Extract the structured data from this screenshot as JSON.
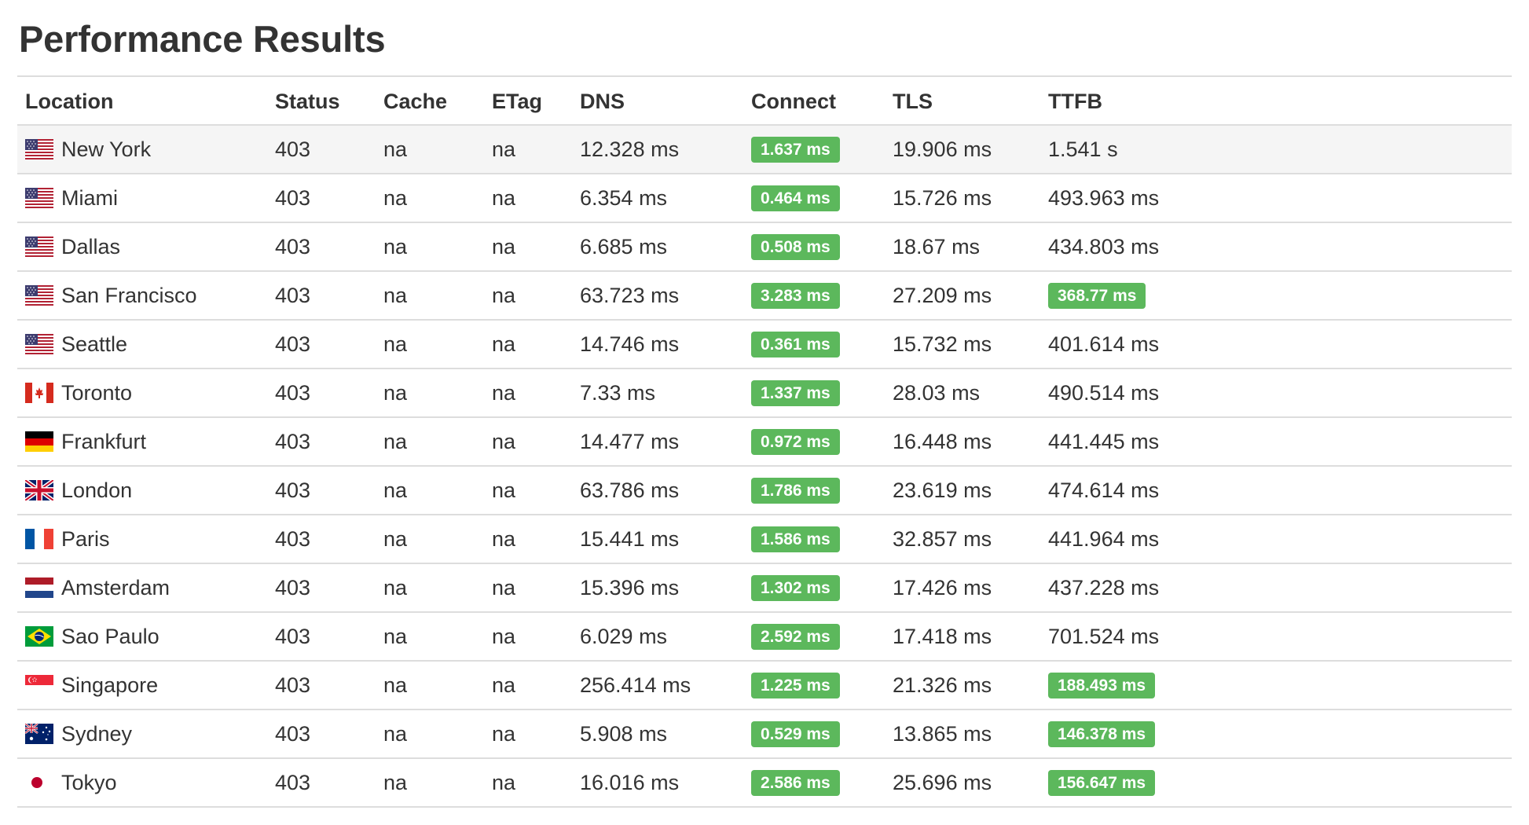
{
  "title": "Performance Results",
  "columns": [
    "Location",
    "Status",
    "Cache",
    "ETag",
    "DNS",
    "Connect",
    "TLS",
    "TTFB"
  ],
  "colors": {
    "badge_green": "#5cb85c",
    "row_highlight": "#f5f5f5",
    "border": "#dddddd"
  },
  "rows": [
    {
      "flag": "us-flag-icon",
      "location": "New York",
      "status": "403",
      "cache": "na",
      "etag": "na",
      "dns": "12.328 ms",
      "connect": "1.637 ms",
      "connect_highlight": true,
      "tls": "19.906 ms",
      "ttfb": "1.541 s",
      "ttfb_highlight": false
    },
    {
      "flag": "us-flag-icon",
      "location": "Miami",
      "status": "403",
      "cache": "na",
      "etag": "na",
      "dns": "6.354 ms",
      "connect": "0.464 ms",
      "connect_highlight": true,
      "tls": "15.726 ms",
      "ttfb": "493.963 ms",
      "ttfb_highlight": false
    },
    {
      "flag": "us-flag-icon",
      "location": "Dallas",
      "status": "403",
      "cache": "na",
      "etag": "na",
      "dns": "6.685 ms",
      "connect": "0.508 ms",
      "connect_highlight": true,
      "tls": "18.67 ms",
      "ttfb": "434.803 ms",
      "ttfb_highlight": false
    },
    {
      "flag": "us-flag-icon",
      "location": "San Francisco",
      "status": "403",
      "cache": "na",
      "etag": "na",
      "dns": "63.723 ms",
      "connect": "3.283 ms",
      "connect_highlight": true,
      "tls": "27.209 ms",
      "ttfb": "368.77 ms",
      "ttfb_highlight": true
    },
    {
      "flag": "us-flag-icon",
      "location": "Seattle",
      "status": "403",
      "cache": "na",
      "etag": "na",
      "dns": "14.746 ms",
      "connect": "0.361 ms",
      "connect_highlight": true,
      "tls": "15.732 ms",
      "ttfb": "401.614 ms",
      "ttfb_highlight": false
    },
    {
      "flag": "ca-flag-icon",
      "location": "Toronto",
      "status": "403",
      "cache": "na",
      "etag": "na",
      "dns": "7.33 ms",
      "connect": "1.337 ms",
      "connect_highlight": true,
      "tls": "28.03 ms",
      "ttfb": "490.514 ms",
      "ttfb_highlight": false
    },
    {
      "flag": "de-flag-icon",
      "location": "Frankfurt",
      "status": "403",
      "cache": "na",
      "etag": "na",
      "dns": "14.477 ms",
      "connect": "0.972 ms",
      "connect_highlight": true,
      "tls": "16.448 ms",
      "ttfb": "441.445 ms",
      "ttfb_highlight": false
    },
    {
      "flag": "gb-flag-icon",
      "location": "London",
      "status": "403",
      "cache": "na",
      "etag": "na",
      "dns": "63.786 ms",
      "connect": "1.786 ms",
      "connect_highlight": true,
      "tls": "23.619 ms",
      "ttfb": "474.614 ms",
      "ttfb_highlight": false
    },
    {
      "flag": "fr-flag-icon",
      "location": "Paris",
      "status": "403",
      "cache": "na",
      "etag": "na",
      "dns": "15.441 ms",
      "connect": "1.586 ms",
      "connect_highlight": true,
      "tls": "32.857 ms",
      "ttfb": "441.964 ms",
      "ttfb_highlight": false
    },
    {
      "flag": "nl-flag-icon",
      "location": "Amsterdam",
      "status": "403",
      "cache": "na",
      "etag": "na",
      "dns": "15.396 ms",
      "connect": "1.302 ms",
      "connect_highlight": true,
      "tls": "17.426 ms",
      "ttfb": "437.228 ms",
      "ttfb_highlight": false
    },
    {
      "flag": "br-flag-icon",
      "location": "Sao Paulo",
      "status": "403",
      "cache": "na",
      "etag": "na",
      "dns": "6.029 ms",
      "connect": "2.592 ms",
      "connect_highlight": true,
      "tls": "17.418 ms",
      "ttfb": "701.524 ms",
      "ttfb_highlight": false
    },
    {
      "flag": "sg-flag-icon",
      "location": "Singapore",
      "status": "403",
      "cache": "na",
      "etag": "na",
      "dns": "256.414 ms",
      "connect": "1.225 ms",
      "connect_highlight": true,
      "tls": "21.326 ms",
      "ttfb": "188.493 ms",
      "ttfb_highlight": true
    },
    {
      "flag": "au-flag-icon",
      "location": "Sydney",
      "status": "403",
      "cache": "na",
      "etag": "na",
      "dns": "5.908 ms",
      "connect": "0.529 ms",
      "connect_highlight": true,
      "tls": "13.865 ms",
      "ttfb": "146.378 ms",
      "ttfb_highlight": true
    },
    {
      "flag": "jp-flag-icon",
      "location": "Tokyo",
      "status": "403",
      "cache": "na",
      "etag": "na",
      "dns": "16.016 ms",
      "connect": "2.586 ms",
      "connect_highlight": true,
      "tls": "25.696 ms",
      "ttfb": "156.647 ms",
      "ttfb_highlight": true
    }
  ]
}
